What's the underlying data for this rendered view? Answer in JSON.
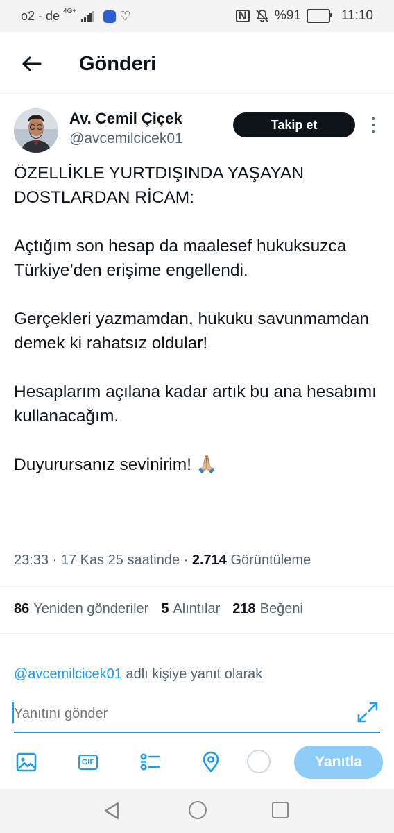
{
  "status": {
    "carrier": "o2 - de",
    "network": "4G+",
    "battery_percent": "%91",
    "time": "11:10"
  },
  "header": {
    "title": "Gönderi"
  },
  "author": {
    "name": "Av. Cemil Çiçek",
    "handle": "@avcemilcicek01",
    "follow_label": "Takip et"
  },
  "tweet": {
    "text": "ÖZELLİKLE YURTDIŞINDA YAŞAYAN DOSTLARDAN RİCAM:\n\nAçtığım son hesap da maalesef hukuksuzca Türkiye’den erişime engellendi.\n\nGerçekleri yazmamdan, hukuku savunmamdan demek ki rahatsız oldular!\n\nHesaplarım açılana kadar artık bu ana hesabımı kullanacağım.\n\nDuyurursanız sevinirim! 🙏🏼",
    "time": "23:33",
    "date": "17 Kas 25 saatinde",
    "views_count": "2.714",
    "views_label": "Görüntüleme"
  },
  "stats": {
    "retweets_count": "86",
    "retweets_label": "Yeniden gönderiler",
    "quotes_count": "5",
    "quotes_label": "Alıntılar",
    "likes_count": "218",
    "likes_label": "Beğeni"
  },
  "reply": {
    "replying_handle": "@avcemilcicek01",
    "replying_suffix": "adlı kişiye yanıt olarak",
    "placeholder": "Yanıtını gönder",
    "submit_label": "Yanıtla",
    "gif_label": "GIF"
  },
  "colors": {
    "accent": "#1d9bf0",
    "reply_button": "#8ecdf8",
    "follow_button": "#0f1419"
  },
  "icons": [
    "back-arrow-icon",
    "more-icon",
    "expand-icon",
    "image-icon",
    "gif-icon",
    "poll-icon",
    "location-icon"
  ]
}
